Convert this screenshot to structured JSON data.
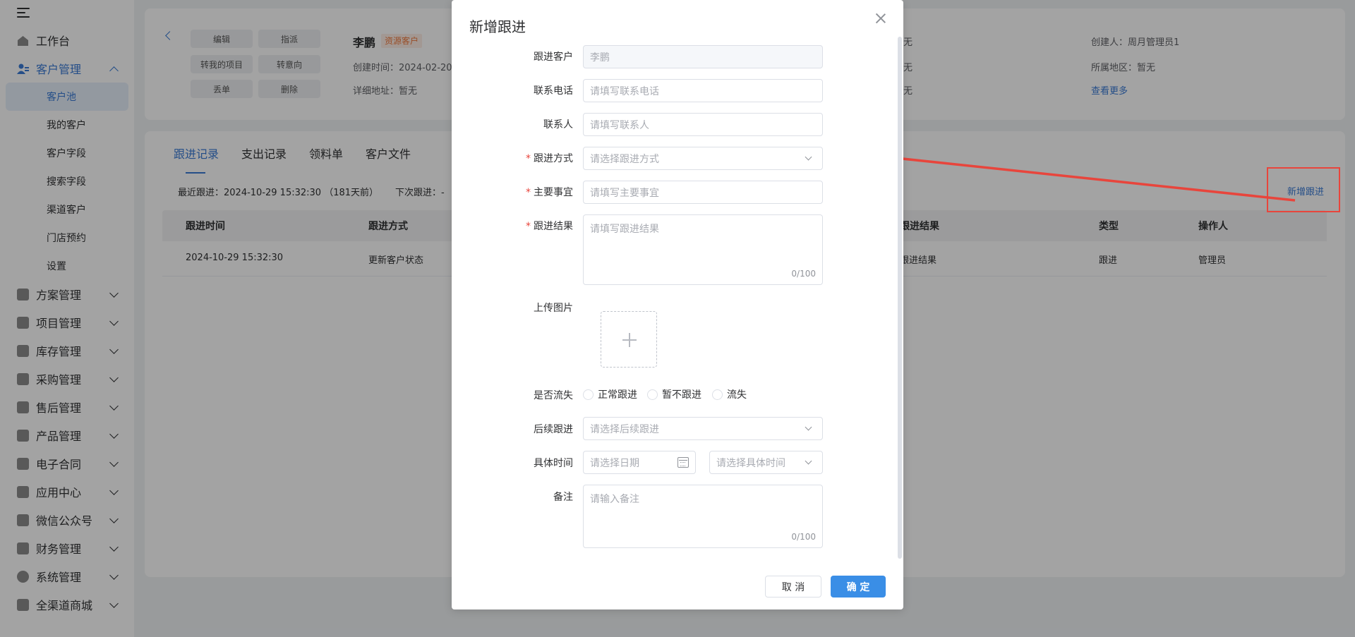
{
  "sidebar": {
    "items": [
      {
        "label": "工作台",
        "icon": "home-icon"
      },
      {
        "label": "客户管理",
        "icon": "customer-icon",
        "open": true,
        "children": [
          "客户池",
          "我的客户",
          "客户字段",
          "搜索字段",
          "渠道客户",
          "门店预约",
          "设置"
        ]
      },
      {
        "label": "方案管理",
        "icon": "plan-icon"
      },
      {
        "label": "项目管理",
        "icon": "folder-icon"
      },
      {
        "label": "库存管理",
        "icon": "inventory-icon"
      },
      {
        "label": "采购管理",
        "icon": "cart-icon"
      },
      {
        "label": "售后管理",
        "icon": "headset-icon"
      },
      {
        "label": "产品管理",
        "icon": "box-icon"
      },
      {
        "label": "电子合同",
        "icon": "contract-icon"
      },
      {
        "label": "应用中心",
        "icon": "apps-icon"
      },
      {
        "label": "微信公众号",
        "icon": "wechat-icon"
      },
      {
        "label": "财务管理",
        "icon": "wallet-icon"
      },
      {
        "label": "系统管理",
        "icon": "settings-icon"
      },
      {
        "label": "全渠道商城",
        "icon": "store-icon"
      }
    ]
  },
  "header": {
    "buttons": [
      "编辑",
      "指派",
      "转我的项目",
      "转意向",
      "丢单",
      "删除"
    ],
    "customer_name": "李鹏",
    "badge": "资源客户",
    "created_time": "创建时间：2024-02-20",
    "address": "详细地址：暂无",
    "col3": [
      "无",
      "无",
      "无"
    ],
    "creator": "创建人：周月管理员1",
    "region": "所属地区：暂无",
    "more_link": "查看更多"
  },
  "tabs": [
    "跟进记录",
    "支出记录",
    "领料单",
    "客户文件"
  ],
  "meta": {
    "last_followup": "最近跟进：2024-10-29 15:32:30 （181天前）",
    "next_followup": "下次跟进：-"
  },
  "add_followup_link": "新增跟进",
  "table": {
    "headers": [
      "跟进时间",
      "跟进方式",
      "跟进结果",
      "类型",
      "操作人"
    ],
    "rows": [
      [
        "2024-10-29 15:32:30",
        "更新客户状态",
        "跟进结果",
        "跟进",
        "管理员"
      ]
    ]
  },
  "modal": {
    "title": "新增跟进",
    "customer_label": "跟进客户",
    "customer_value": "李鹏",
    "phone_label": "联系电话",
    "phone_placeholder": "请填写联系电话",
    "contact_label": "联系人",
    "contact_placeholder": "请填写联系人",
    "method_label": "跟进方式",
    "method_placeholder": "请选择跟进方式",
    "matter_label": "主要事宜",
    "matter_placeholder": "请填写主要事宜",
    "result_label": "跟进结果",
    "result_placeholder": "请填写跟进结果",
    "result_count": "0/100",
    "upload_label": "上传图片",
    "lost_label": "是否流失",
    "lost_options": [
      "正常跟进",
      "暂不跟进",
      "流失"
    ],
    "next_label": "后续跟进",
    "next_placeholder": "请选择后续跟进",
    "time_label": "具体时间",
    "date_placeholder": "请选择日期",
    "time_placeholder": "请选择具体时间",
    "note_label": "备注",
    "note_placeholder": "请输入备注",
    "note_count": "0/100",
    "cancel": "取 消",
    "confirm": "确 定"
  },
  "colors": {
    "accent": "#3a7bd5",
    "annotation": "#e8453c",
    "badge": "#f07b3f"
  }
}
